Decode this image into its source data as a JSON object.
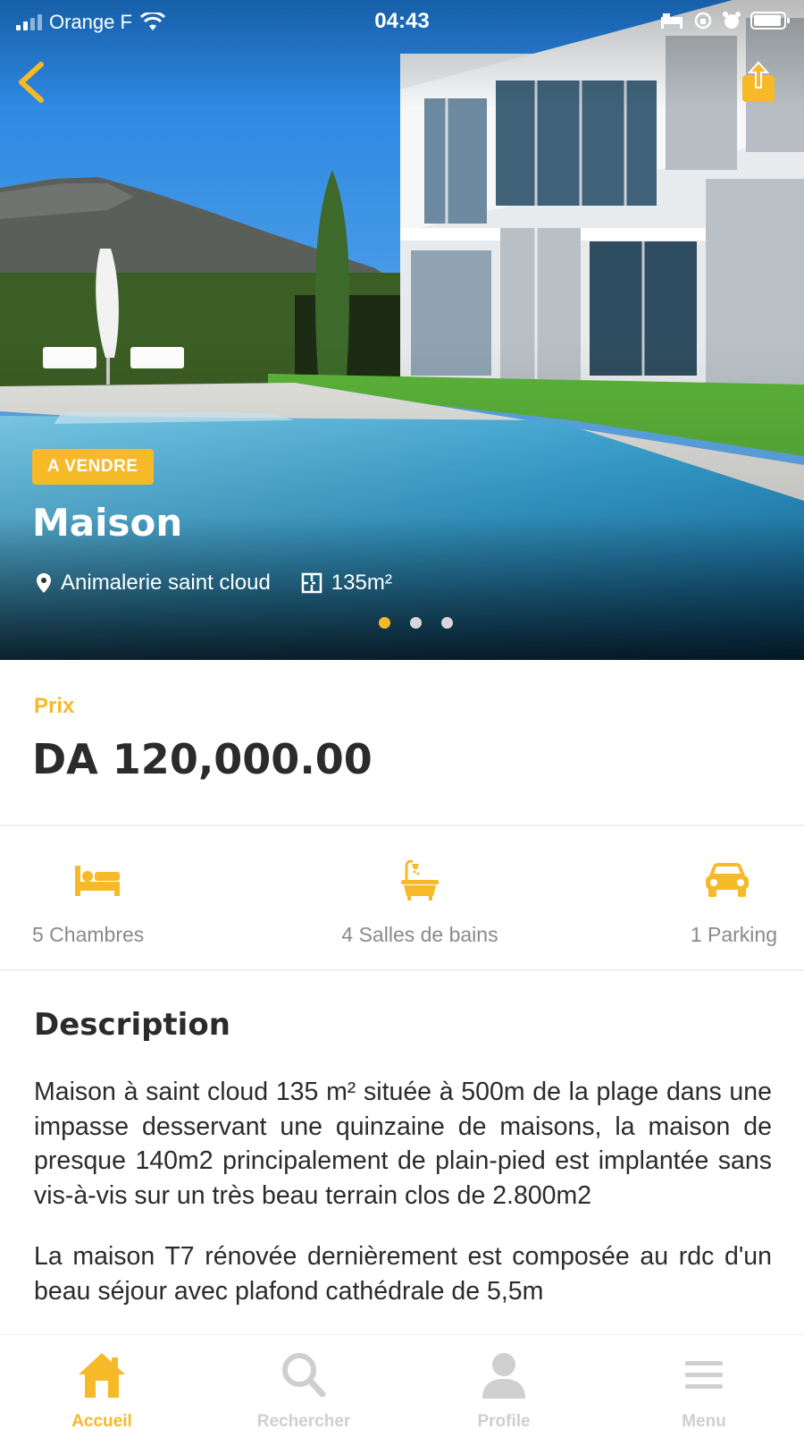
{
  "status_bar": {
    "carrier": "Orange F",
    "time": "04:43",
    "icons": [
      "signal-icon",
      "wifi-icon",
      "bed-status-icon",
      "orientation-lock-icon",
      "alarm-icon",
      "battery-icon"
    ]
  },
  "nav": {
    "back_icon": "chevron-left-icon",
    "share_icon": "share-icon"
  },
  "hero": {
    "image": "modern-house-with-pool-photo",
    "badge": "A VENDRE",
    "title": "Maison",
    "location": "Animalerie saint cloud",
    "area": "135m²",
    "carousel": {
      "total": 3,
      "active": 1
    }
  },
  "price": {
    "label": "Prix",
    "value": "DA 120,000.00"
  },
  "features": [
    {
      "icon": "bed-icon",
      "label": "5 Chambres"
    },
    {
      "icon": "bathtub-icon",
      "label": "4 Salles de bains"
    },
    {
      "icon": "car-icon",
      "label": "1 Parking"
    }
  ],
  "description": {
    "title": "Description",
    "paragraphs": [
      "Maison à saint cloud 135 m² située à 500m de la plage dans une impasse desservant une quinzaine de maisons, la maison de presque 140m2 principalement de plain-pied est implantée sans vis-à-vis sur un très beau terrain clos de 2.800m2",
      "La maison T7 rénovée dernièrement est composée au rdc d'un beau séjour avec plafond cathédrale de 5,5m"
    ]
  },
  "tabbar": {
    "active": "Accueil",
    "tabs": [
      {
        "icon": "home-icon",
        "label": "Accueil"
      },
      {
        "icon": "search-icon",
        "label": "Rechercher"
      },
      {
        "icon": "user-icon",
        "label": "Profile"
      },
      {
        "icon": "menu-icon",
        "label": "Menu"
      }
    ]
  },
  "colors": {
    "accent": "#f6b928",
    "text": "#2b2b2b",
    "muted": "#8a8a8a",
    "inactive_tab": "#cfcfcf"
  }
}
